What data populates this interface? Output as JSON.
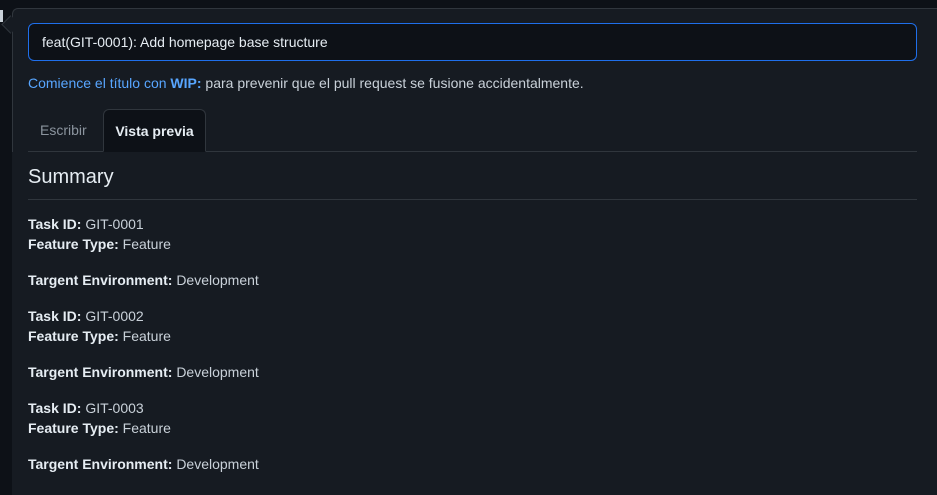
{
  "title_field": {
    "value": "feat(GIT-0001): Add homepage base structure"
  },
  "hint": {
    "prefix": "Comience el título con",
    "keyword": "WIP:",
    "suffix": "para prevenir que el pull request se fusione accidentalmente."
  },
  "tabs": [
    {
      "label": "Escribir",
      "active": false
    },
    {
      "label": "Vista previa",
      "active": true
    }
  ],
  "preview": {
    "heading": "Summary",
    "entries": [
      {
        "task_id_label": "Task ID:",
        "task_id": "GIT-0001",
        "feature_type_label": "Feature Type:",
        "feature_type": "Feature",
        "environment_label": "Targent Environment:",
        "environment": "Development"
      },
      {
        "task_id_label": "Task ID:",
        "task_id": "GIT-0002",
        "feature_type_label": "Feature Type:",
        "feature_type": "Feature",
        "environment_label": "Targent Environment:",
        "environment": "Development"
      },
      {
        "task_id_label": "Task ID:",
        "task_id": "GIT-0003",
        "feature_type_label": "Feature Type:",
        "feature_type": "Feature",
        "environment_label": "Targent Environment:",
        "environment": "Development"
      }
    ]
  },
  "colors": {
    "accent": "#1f6feb",
    "link": "#58a6ff",
    "background": "#0d1117",
    "panel": "#161b22",
    "border": "#30363d"
  }
}
